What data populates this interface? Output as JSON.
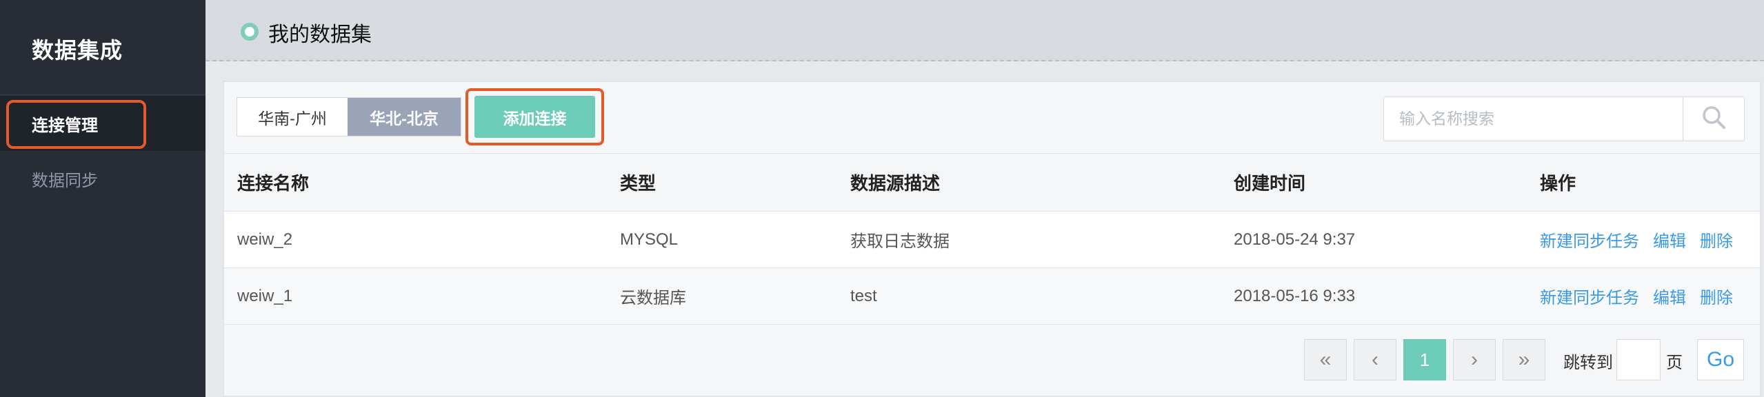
{
  "sidebar": {
    "brand": "数据集成",
    "items": [
      {
        "label": "连接管理",
        "active": true
      },
      {
        "label": "数据同步",
        "active": false
      }
    ]
  },
  "header": {
    "title": "我的数据集"
  },
  "toolbar": {
    "regions": [
      {
        "label": "华南-广州",
        "active": false
      },
      {
        "label": "华北-北京",
        "active": true
      }
    ],
    "add_label": "添加连接",
    "search_placeholder": "输入名称搜索"
  },
  "table": {
    "columns": [
      "连接名称",
      "类型",
      "数据源描述",
      "创建时间",
      "操作"
    ],
    "rows": [
      {
        "name": "weiw_2",
        "type": "MYSQL",
        "desc": "获取日志数据",
        "created": "2018-05-24 9:37"
      },
      {
        "name": "weiw_1",
        "type": "云数据库",
        "desc": "test",
        "created": "2018-05-16 9:33"
      }
    ],
    "actions": {
      "new_task": "新建同步任务",
      "edit": "编辑",
      "delete": "删除"
    }
  },
  "pagination": {
    "first": "«",
    "prev": "‹",
    "current": "1",
    "next": "›",
    "last": "»",
    "jump_label": "跳转到",
    "page_suffix": "页",
    "go_label": "Go"
  },
  "colors": {
    "sidebar_bg": "#272c35",
    "accent": "#6dccb7",
    "region_active": "#9aa3b7",
    "link": "#3a9ae8",
    "highlight": "#e55a2b"
  },
  "icons": {
    "header_dot": "circle-icon",
    "search": "search-icon"
  }
}
